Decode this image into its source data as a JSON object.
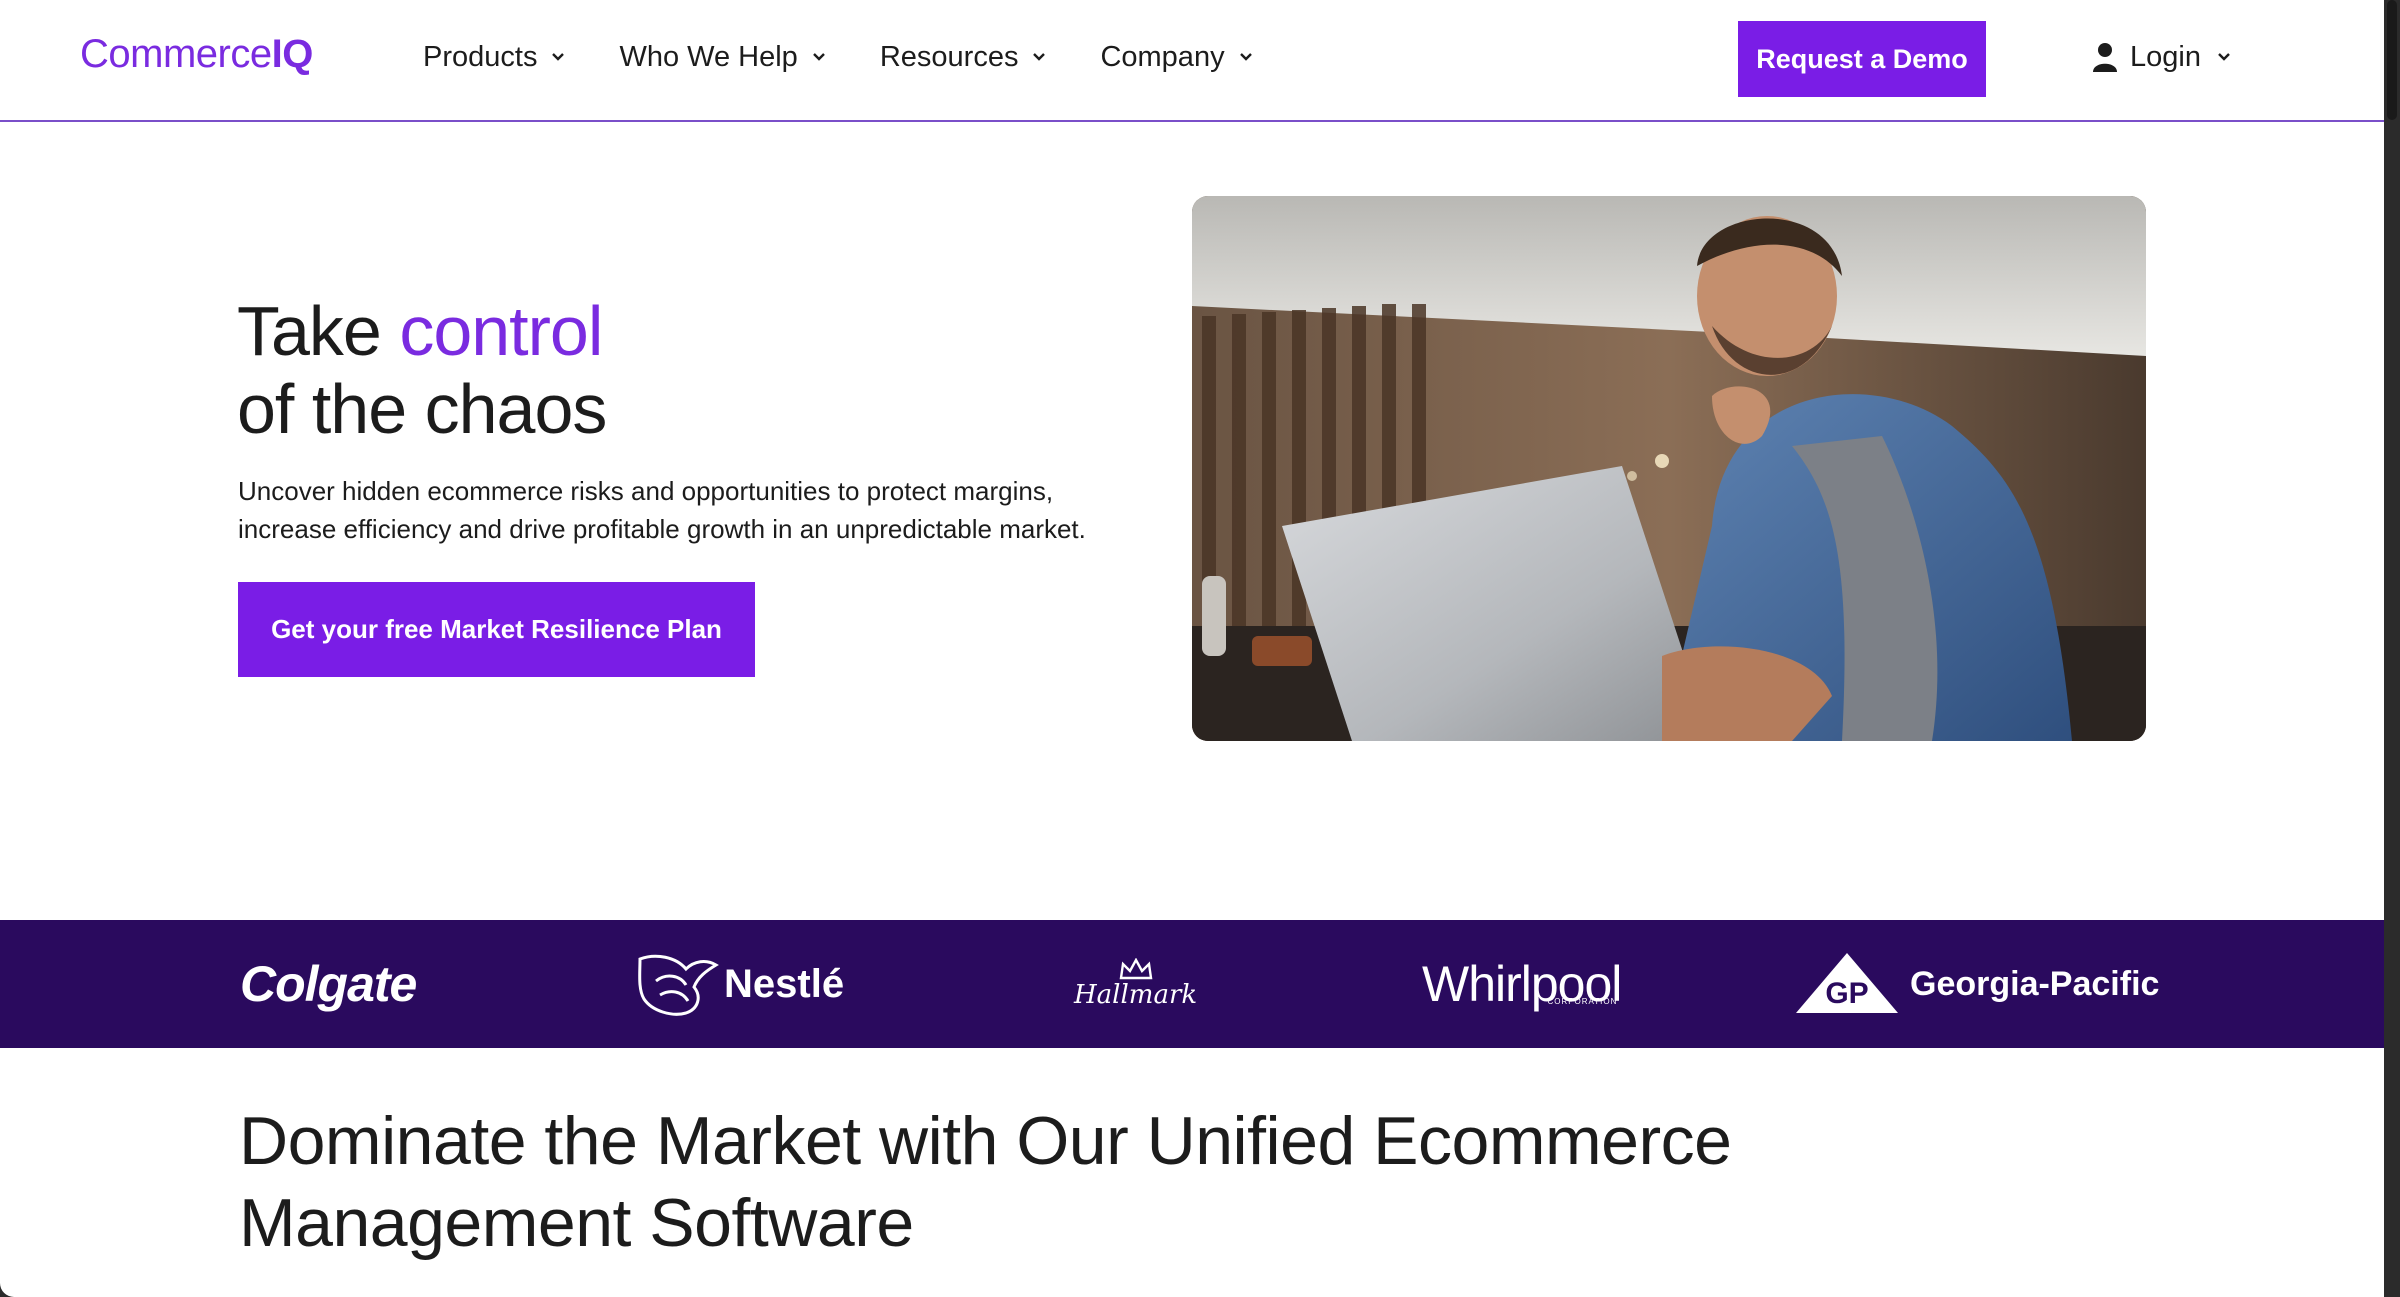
{
  "header": {
    "logo_part1": "Commerce",
    "logo_part2": "IQ",
    "nav": [
      {
        "label": "Products"
      },
      {
        "label": "Who We Help"
      },
      {
        "label": "Resources"
      },
      {
        "label": "Company"
      }
    ],
    "demo_label": "Request a Demo",
    "login_label": "Login"
  },
  "hero": {
    "title_word1": "Take ",
    "title_accent": "control",
    "title_line2": "of the chaos",
    "description": "Uncover hidden ecommerce risks and opportunities to protect margins, increase efficiency and drive profitable growth in an unpredictable market.",
    "cta_label": "Get your free Market Resilience Plan"
  },
  "brands": {
    "colgate": "Colgate",
    "nestle": "Nestlé",
    "hallmark": "Hallmark",
    "whirlpool": "Whirlpool",
    "whirlpool_sub": "CORPORATION",
    "gp_badge": "GP",
    "gp": "Georgia-Pacific"
  },
  "section": {
    "title": "Dominate the Market with Our Unified Ecommerce Management Software"
  },
  "colors": {
    "accent": "#7a1de6",
    "band": "#2a0a5e",
    "text": "#1c1c1c"
  }
}
